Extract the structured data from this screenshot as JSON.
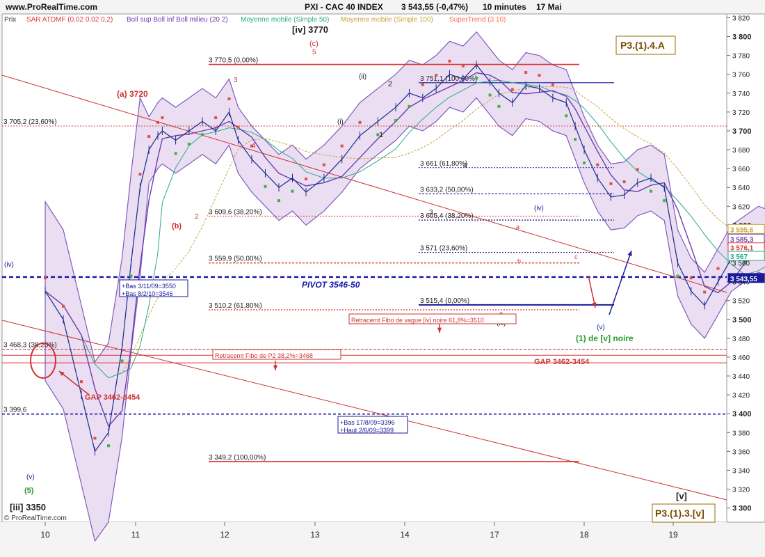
{
  "header": {
    "site": "www.ProRealTime.com",
    "title": "PXI - CAC 40 INDEX",
    "quote": "3 543,55 (-0,47%)",
    "period": "10 minutes",
    "date": "17 Mai",
    "prix_label": "Prix",
    "watermark": "© ProRealTime.com"
  },
  "indicators": [
    {
      "label": "SAR ATDMF (0,02 0,02 0,2)",
      "color": "#e03b3b"
    },
    {
      "label": "Boll sup Boll inf Boll milieu (20 2)",
      "color": "#6a3fb0"
    },
    {
      "label": "Moyenne mobile (Simple 50)",
      "color": "#2aa88a"
    },
    {
      "label": "Moyenne mobile (Simple 100)",
      "color": "#c9a23a"
    },
    {
      "label": "SuperTrend (3 10)",
      "color": "#ff6b4a"
    }
  ],
  "chart_data": {
    "type": "line",
    "ylim": [
      3290,
      3825
    ],
    "x_ticks": [
      "10",
      "11",
      "12",
      "13",
      "14",
      "17",
      "18",
      "19"
    ],
    "y_ticks": [
      3300,
      3320,
      3340,
      3360,
      3380,
      3400,
      3420,
      3440,
      3460,
      3480,
      3500,
      3520,
      3540,
      3560,
      3580,
      3600,
      3620,
      3640,
      3660,
      3680,
      3700,
      3720,
      3740,
      3760,
      3780,
      3800,
      3820
    ],
    "y_major": [
      3300,
      3400,
      3500,
      3600,
      3700,
      3800
    ],
    "price_series": {
      "name": "CAC 40",
      "x": [
        0,
        0.2,
        0.4,
        0.55,
        0.7,
        0.85,
        0.95,
        1.05,
        1.15,
        1.25,
        1.3,
        1.45,
        1.6,
        1.75,
        1.9,
        2.05,
        2.15,
        2.3,
        2.45,
        2.6,
        2.75,
        2.9,
        3.1,
        3.3,
        3.5,
        3.7,
        3.9,
        4.05,
        4.2,
        4.35,
        4.5,
        4.65,
        4.8,
        4.95,
        5.05,
        5.2,
        5.35,
        5.5,
        5.65,
        5.8,
        5.9,
        6.0,
        6.15,
        6.3,
        6.45,
        6.6,
        6.75,
        6.9,
        7.05,
        7.2,
        7.35,
        7.5,
        7.65,
        7.8,
        7.95,
        8.1,
        8.3,
        8.45,
        8.6,
        8.75,
        8.9,
        9.05,
        9.2,
        9.3,
        9.4,
        9.5,
        9.55,
        9.6
      ],
      "y": [
        3530,
        3500,
        3420,
        3360,
        3380,
        3470,
        3560,
        3640,
        3680,
        3695,
        3700,
        3690,
        3700,
        3710,
        3700,
        3720,
        3690,
        3670,
        3655,
        3640,
        3650,
        3635,
        3650,
        3670,
        3695,
        3710,
        3725,
        3740,
        3735,
        3745,
        3760,
        3755,
        3770,
        3752,
        3740,
        3730,
        3748,
        3745,
        3735,
        3730,
        3705,
        3680,
        3650,
        3630,
        3632,
        3645,
        3650,
        3640,
        3560,
        3530,
        3515,
        3540,
        3565,
        3575,
        3585,
        3580,
        3565,
        3580,
        3570,
        3575,
        3560,
        3570,
        3578,
        3560,
        3555,
        3545,
        3548,
        3543
      ]
    },
    "price_current": 3543.55,
    "horizontal_levels": [
      {
        "label": "3 770,5 (0,00%)",
        "value": 3770.5
      },
      {
        "label": "3 705,2 (23,60%)",
        "value": 3705.2
      },
      {
        "label": "3 609,6 (38,20%)",
        "value": 3609.6
      },
      {
        "label": "3 559,9 (50,00%)",
        "value": 3559.9
      },
      {
        "label": "3 510,2 (61,80%)",
        "value": 3510.2
      },
      {
        "label": "3 468,3 (38,20%)",
        "value": 3468.3
      },
      {
        "label": "3 399,6",
        "value": 3399.6
      },
      {
        "label": "3 349,2 (100,00%)",
        "value": 3349.2
      },
      {
        "label": "3 751,1 (100,00%)",
        "value": 3751.1
      },
      {
        "label": "3 661 (61,80%)",
        "value": 3661
      },
      {
        "label": "3 633,2 (50,00%)",
        "value": 3633.2
      },
      {
        "label": "3 605,4 (38,20%)",
        "value": 3605.4
      },
      {
        "label": "3 571 (23,60%)",
        "value": 3571
      },
      {
        "label": "3 515,4 (0,00%)",
        "value": 3515.4
      }
    ],
    "right_labels": [
      {
        "label": "3 595,6",
        "value": 3595.6,
        "color": "#c9a23a"
      },
      {
        "label": "3 585,3",
        "value": 3585.3,
        "color": "#6a3fb0"
      },
      {
        "label": "3 576,1",
        "value": 3576.1,
        "color": "#e03b3b"
      },
      {
        "label": "3 567",
        "value": 3567,
        "color": "#2aa88a"
      },
      {
        "label": "3 543,55",
        "value": 3543.55,
        "color": "#1a1a9a"
      }
    ],
    "annotations": {
      "wave_iv_top": "[iv] 3770",
      "wave_c": "(c)",
      "wave_5_c": "5",
      "wave_a": "(a) 3720",
      "wave_b": "(b)",
      "wave_2_red": "2",
      "wave_3_red": "3",
      "wave_4_red": "4",
      "wave_ii": "(ii)",
      "wave_i": "(i)",
      "wave_1": "1",
      "wave_2": "2",
      "wave_3": "3",
      "wave_4": "4",
      "wave_iv_right": "(iv)",
      "wave_a_small": "a",
      "wave_b_small": "b",
      "wave_c_small": "c",
      "wave_5": "5",
      "wave_iii": "(iii)",
      "wave_iv_left": "(iv)",
      "wave_v_left": "(v)",
      "wave_5_green": "(5)",
      "wave_iii_bottom": "[iii] 3350",
      "wave_v_right": "(v)",
      "wave_1_v": "(1) de [v] noire",
      "wave_v_bracket": "[v]",
      "p3_top": "P3.(1).4.A",
      "p3_bottom": "P3.(1).3.[v]",
      "pivot": "PIVOT 3546-50",
      "gap_right": "GAP 3462-3454",
      "gap_left": "GAP 3462-3454",
      "retracement_p2": "Retracemt Fibo de P2 38,2%=3468",
      "retracement_iv": "Retracemt Fibo de vague [iv] noire 61,8%=3510",
      "box1_line1": "+Bas 3/11/09=3550",
      "box1_line2": "+Bas 8/2/10=3546",
      "box2_line1": "+Bas 17/8/09=3396",
      "box2_line2": "+Haut 2/6/09=3399"
    }
  }
}
